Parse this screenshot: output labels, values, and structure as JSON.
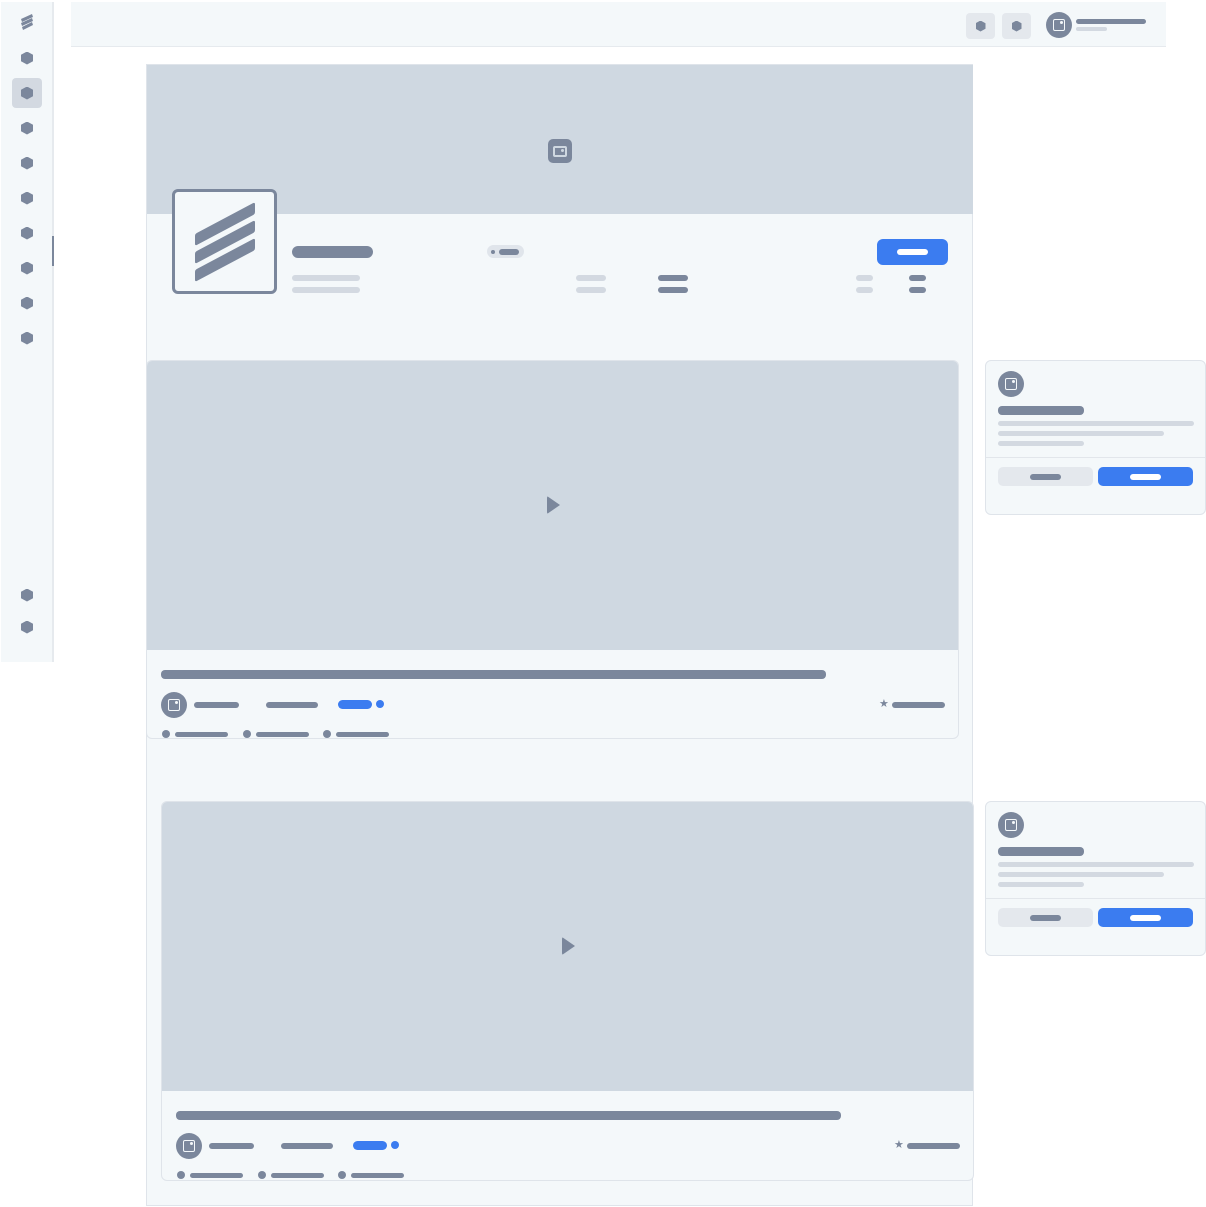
{
  "app": {
    "logo_icon": "brand-stripes-icon",
    "active_nav_index": 2
  },
  "sidebar": {
    "items": [
      {
        "icon": "nav-hex-icon"
      },
      {
        "icon": "nav-hex-icon"
      },
      {
        "icon": "nav-hex-icon"
      },
      {
        "icon": "nav-hex-icon"
      },
      {
        "icon": "nav-hex-icon"
      },
      {
        "icon": "nav-hex-icon"
      },
      {
        "icon": "nav-hex-icon"
      },
      {
        "icon": "nav-hex-icon"
      },
      {
        "icon": "nav-hex-icon"
      }
    ],
    "bottom_items": [
      {
        "icon": "nav-hex-icon"
      },
      {
        "icon": "nav-hex-icon"
      }
    ]
  },
  "header": {
    "actions": [
      {
        "icon": "hex-icon"
      },
      {
        "icon": "hex-icon"
      }
    ],
    "user_avatar_icon": "image-icon"
  },
  "profile": {
    "cover_icon": "image-icon",
    "logo_icon": "brand-stripes-icon"
  },
  "posts": [
    {
      "video_icon": "play-icon",
      "avatar_icon": "image-icon",
      "rating_icon": "star-icon"
    },
    {
      "video_icon": "play-icon",
      "avatar_icon": "image-icon",
      "rating_icon": "star-icon"
    }
  ],
  "side_cards": [
    {
      "avatar_icon": "image-icon"
    },
    {
      "avatar_icon": "image-icon"
    }
  ],
  "colors": {
    "accent": "#3b7cf0",
    "placeholder_dark": "#7b879c",
    "placeholder_light": "#d3d9e1",
    "media_bg": "#cfd8e1",
    "surface": "#f4f8fa"
  }
}
